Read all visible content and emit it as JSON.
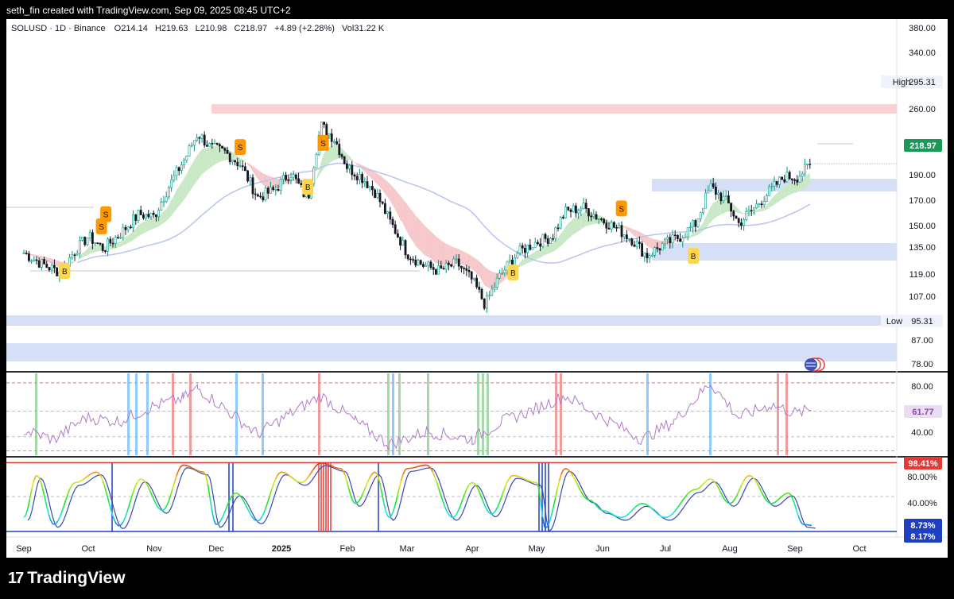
{
  "header": {
    "credit": "seth_fin created with TradingView.com, Sep 09, 2025 08:45 UTC+2"
  },
  "legend": {
    "symbol": "SOLUSD · 1D · Binance",
    "o_label": "O",
    "o_value": "214.14",
    "h_label": "H",
    "h_value": "219.63",
    "l_label": "L",
    "l_value": "210.98",
    "c_label": "C",
    "c_value": "218.97",
    "change": "+4.89 (+2.28%)",
    "vol_label": "Vol",
    "vol_value": "31.22 K"
  },
  "brand": {
    "logo": "17",
    "name": "TradingView"
  },
  "colors": {
    "up": "#089981",
    "down": "#131722",
    "rsi": "#b07cc6",
    "ribbon_green": "#c9e8c6",
    "ribbon_red": "#f6c8cb",
    "zone_blue": "#d5e0f6",
    "zone_red": "#f8d2d5",
    "price_tag": "#1a9a58",
    "buy": "#ffd54a",
    "sell": "#ff9800"
  },
  "chart_data": [
    {
      "type": "candlestick",
      "title": "SOLUSD · 1D · Binance",
      "ylim": [
        78,
        380
      ],
      "y_scale": "log",
      "y_ticks": [
        "380.00",
        "340.00",
        "260.00",
        "190.00",
        "170.00",
        "150.00",
        "135.00",
        "119.00",
        "107.00",
        "87.00",
        "78.00"
      ],
      "x_ticks": [
        "Sep",
        "Oct",
        "Nov",
        "Dec",
        "2025",
        "Feb",
        "Mar",
        "Apr",
        "May",
        "Jun",
        "Jul",
        "Aug",
        "Sep",
        "Oct"
      ],
      "last_price": "218.97",
      "high": {
        "label": "High",
        "value": "295.31"
      },
      "low": {
        "label": "Low",
        "value": "95.31"
      },
      "close_series": [
        {
          "date": "Sep 01",
          "close": 140
        },
        {
          "date": "Sep 10",
          "close": 132
        },
        {
          "date": "Sep 18",
          "close": 127
        },
        {
          "date": "Sep 25",
          "close": 142
        },
        {
          "date": "Oct 01",
          "close": 152
        },
        {
          "date": "Oct 08",
          "close": 143
        },
        {
          "date": "Oct 16",
          "close": 155
        },
        {
          "date": "Oct 24",
          "close": 170
        },
        {
          "date": "Nov 01",
          "close": 168
        },
        {
          "date": "Nov 08",
          "close": 195
        },
        {
          "date": "Nov 16",
          "close": 225
        },
        {
          "date": "Nov 22",
          "close": 255
        },
        {
          "date": "Nov 28",
          "close": 238
        },
        {
          "date": "Dec 05",
          "close": 232
        },
        {
          "date": "Dec 12",
          "close": 218
        },
        {
          "date": "Dec 20",
          "close": 185
        },
        {
          "date": "Dec 28",
          "close": 192
        },
        {
          "date": "Jan 05",
          "close": 210
        },
        {
          "date": "Jan 13",
          "close": 182
        },
        {
          "date": "Jan 19",
          "close": 265
        },
        {
          "date": "Jan 25",
          "close": 248
        },
        {
          "date": "Feb 01",
          "close": 215
        },
        {
          "date": "Feb 08",
          "close": 205
        },
        {
          "date": "Feb 15",
          "close": 190
        },
        {
          "date": "Feb 22",
          "close": 165
        },
        {
          "date": "Mar 01",
          "close": 140
        },
        {
          "date": "Mar 08",
          "close": 132
        },
        {
          "date": "Mar 16",
          "close": 128
        },
        {
          "date": "Mar 24",
          "close": 133
        },
        {
          "date": "Apr 01",
          "close": 122
        },
        {
          "date": "Apr 07",
          "close": 108
        },
        {
          "date": "Apr 14",
          "close": 125
        },
        {
          "date": "Apr 22",
          "close": 140
        },
        {
          "date": "May 01",
          "close": 148
        },
        {
          "date": "May 08",
          "close": 152
        },
        {
          "date": "May 14",
          "close": 172
        },
        {
          "date": "May 22",
          "close": 176
        },
        {
          "date": "Jun 01",
          "close": 165
        },
        {
          "date": "Jun 08",
          "close": 158
        },
        {
          "date": "Jun 15",
          "close": 150
        },
        {
          "date": "Jun 22",
          "close": 138
        },
        {
          "date": "Jun 30",
          "close": 146
        },
        {
          "date": "Jul 08",
          "close": 152
        },
        {
          "date": "Jul 15",
          "close": 162
        },
        {
          "date": "Jul 22",
          "close": 195
        },
        {
          "date": "Jul 30",
          "close": 180
        },
        {
          "date": "Aug 05",
          "close": 162
        },
        {
          "date": "Aug 12",
          "close": 175
        },
        {
          "date": "Aug 19",
          "close": 190
        },
        {
          "date": "Aug 26",
          "close": 205
        },
        {
          "date": "Sep 02",
          "close": 205
        },
        {
          "date": "Sep 09",
          "close": 218.97
        }
      ],
      "markers": [
        {
          "date": "Sep 20",
          "type": "B",
          "price": 128
        },
        {
          "date": "Oct 07",
          "type": "S",
          "price": 160
        },
        {
          "date": "Oct 09",
          "type": "S",
          "price": 170
        },
        {
          "date": "Dec 12",
          "type": "S",
          "price": 238
        },
        {
          "date": "Jan 13",
          "type": "B",
          "price": 195
        },
        {
          "date": "Jan 20",
          "type": "S",
          "price": 243
        },
        {
          "date": "Apr 20",
          "type": "B",
          "price": 127
        },
        {
          "date": "Jun 10",
          "type": "S",
          "price": 175
        },
        {
          "date": "Jul 14",
          "type": "B",
          "price": 138
        }
      ]
    },
    {
      "type": "line",
      "title": "RSI",
      "ylim": [
        25,
        90
      ],
      "y_ticks": [
        "80.00",
        "40.00"
      ],
      "last_value": "61.77",
      "points": [
        {
          "date": "Sep 01",
          "value": 45
        },
        {
          "date": "Sep 15",
          "value": 38
        },
        {
          "date": "Sep 30",
          "value": 55
        },
        {
          "date": "Oct 15",
          "value": 52
        },
        {
          "date": "Oct 31",
          "value": 64
        },
        {
          "date": "Nov 15",
          "value": 70
        },
        {
          "date": "Nov 22",
          "value": 78
        },
        {
          "date": "Dec 05",
          "value": 62
        },
        {
          "date": "Dec 20",
          "value": 42
        },
        {
          "date": "Jan 05",
          "value": 58
        },
        {
          "date": "Jan 19",
          "value": 72
        },
        {
          "date": "Feb 05",
          "value": 52
        },
        {
          "date": "Feb 22",
          "value": 34
        },
        {
          "date": "Mar 10",
          "value": 44
        },
        {
          "date": "Apr 01",
          "value": 38
        },
        {
          "date": "Apr 15",
          "value": 52
        },
        {
          "date": "May 01",
          "value": 62
        },
        {
          "date": "May 14",
          "value": 72
        },
        {
          "date": "Jun 01",
          "value": 55
        },
        {
          "date": "Jun 20",
          "value": 38
        },
        {
          "date": "Jul 05",
          "value": 52
        },
        {
          "date": "Jul 22",
          "value": 82
        },
        {
          "date": "Aug 05",
          "value": 55
        },
        {
          "date": "Aug 20",
          "value": 65
        },
        {
          "date": "Sep 02",
          "value": 58
        },
        {
          "date": "Sep 09",
          "value": 61.77
        }
      ]
    },
    {
      "type": "line",
      "title": "Stochastic",
      "ylim": [
        0,
        100
      ],
      "y_ticks": [
        "80.00%",
        "40.00%"
      ],
      "tags": [
        "98.41%",
        "8.73%",
        "8.17%"
      ],
      "points": [
        {
          "date": "Sep 01",
          "value": 20
        },
        {
          "date": "Sep 07",
          "value": 80
        },
        {
          "date": "Sep 15",
          "value": 10
        },
        {
          "date": "Sep 25",
          "value": 70
        },
        {
          "date": "Oct 05",
          "value": 85
        },
        {
          "date": "Oct 15",
          "value": 8
        },
        {
          "date": "Oct 25",
          "value": 75
        },
        {
          "date": "Nov 05",
          "value": 30
        },
        {
          "date": "Nov 15",
          "value": 95
        },
        {
          "date": "Nov 25",
          "value": 85
        },
        {
          "date": "Dec 01",
          "value": 10
        },
        {
          "date": "Dec 10",
          "value": 55
        },
        {
          "date": "Dec 20",
          "value": 15
        },
        {
          "date": "Jan 01",
          "value": 85
        },
        {
          "date": "Jan 10",
          "value": 70
        },
        {
          "date": "Jan 19",
          "value": 98
        },
        {
          "date": "Jan 28",
          "value": 90
        },
        {
          "date": "Feb 05",
          "value": 40
        },
        {
          "date": "Feb 15",
          "value": 85
        },
        {
          "date": "Feb 22",
          "value": 20
        },
        {
          "date": "Mar 01",
          "value": 90
        },
        {
          "date": "Mar 10",
          "value": 95
        },
        {
          "date": "Mar 22",
          "value": 20
        },
        {
          "date": "Apr 01",
          "value": 70
        },
        {
          "date": "Apr 10",
          "value": 25
        },
        {
          "date": "Apr 20",
          "value": 80
        },
        {
          "date": "May 01",
          "value": 70
        },
        {
          "date": "May 05",
          "value": 5
        },
        {
          "date": "May 14",
          "value": 90
        },
        {
          "date": "May 25",
          "value": 45
        },
        {
          "date": "Jun 01",
          "value": 30
        },
        {
          "date": "Jun 10",
          "value": 20
        },
        {
          "date": "Jun 20",
          "value": 40
        },
        {
          "date": "Jul 01",
          "value": 20
        },
        {
          "date": "Jul 15",
          "value": 60
        },
        {
          "date": "Jul 22",
          "value": 75
        },
        {
          "date": "Aug 01",
          "value": 40
        },
        {
          "date": "Aug 10",
          "value": 80
        },
        {
          "date": "Aug 20",
          "value": 40
        },
        {
          "date": "Aug 28",
          "value": 55
        },
        {
          "date": "Sep 05",
          "value": 10
        },
        {
          "date": "Sep 09",
          "value": 8.73
        }
      ]
    }
  ]
}
